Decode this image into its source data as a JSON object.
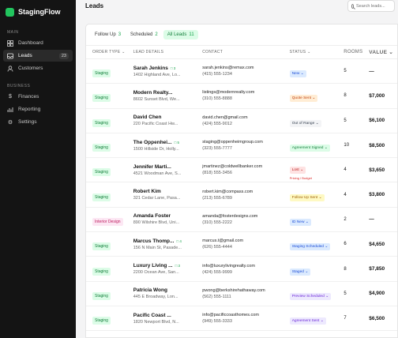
{
  "app": {
    "name": "StagingFlow"
  },
  "sidebar": {
    "section_main": "MAIN",
    "section_business": "BUSINESS",
    "items": [
      {
        "label": "Dashboard",
        "icon": "grid-icon"
      },
      {
        "label": "Leads",
        "icon": "inbox-icon",
        "badge": "23"
      },
      {
        "label": "Customers",
        "icon": "user-icon"
      },
      {
        "label": "Finances",
        "icon": "dollar-icon"
      },
      {
        "label": "Reporting",
        "icon": "chart-icon"
      },
      {
        "label": "Settings",
        "icon": "gear-icon"
      }
    ]
  },
  "header": {
    "title": "Leads",
    "search_placeholder": "Search leads..."
  },
  "tabs": [
    {
      "label": "Follow Up",
      "count": "3"
    },
    {
      "label": "Scheduled",
      "count": "2"
    },
    {
      "label": "All Leads",
      "count": "11"
    }
  ],
  "columns": [
    "ORDER TYPE ⌄",
    "LEAD DETAILS",
    "CONTACT",
    "STATUS ⌄",
    "ROOMS",
    "VALUE ⌄"
  ],
  "rows": [
    {
      "type": "Staging",
      "name": "Sarah Jenkins",
      "count": "□ 3",
      "address": "1402 Highland Ave, Lo...",
      "email": "sarah.jenkins@remax.com",
      "phone": "(415) 555-1234",
      "status": "New ⌄",
      "status_sub": "",
      "rooms": "5",
      "value": "—"
    },
    {
      "type": "Staging",
      "name": "Modern Realty...",
      "count": "",
      "address": "8602 Sunset Blvd, We...",
      "email": "listings@modernrealty.com",
      "phone": "(310) 555-8888",
      "status": "Quote Sent ⌄",
      "status_sub": "",
      "rooms": "8",
      "value": "$7,000"
    },
    {
      "type": "Staging",
      "name": "David Chen",
      "count": "",
      "address": "220 Pacific Coast Hw...",
      "email": "david.chen@gmail.com",
      "phone": "(424) 555-9012",
      "status": "Out of Range ⌄",
      "status_sub": "",
      "rooms": "5",
      "value": "$6,100"
    },
    {
      "type": "Staging",
      "name": "The Oppenhei...",
      "count": "□ 5",
      "address": "1500 Hillside Dr, Holly...",
      "email": "staging@oppenheimgroup.com",
      "phone": "(323) 555-7777",
      "status": "Agreement Signed ⌄",
      "status_sub": "",
      "rooms": "10",
      "value": "$8,500"
    },
    {
      "type": "Staging",
      "name": "Jennifer Marti...",
      "count": "",
      "address": "4521 Woodman Ave, S...",
      "email": "jmartinez@coldwellbanker.com",
      "phone": "(818) 555-3456",
      "status": "Lost ⌄",
      "status_sub": "Pricing / Budget",
      "rooms": "4",
      "value": "$3,650"
    },
    {
      "type": "Staging",
      "name": "Robert Kim",
      "count": "",
      "address": "321 Cedar Lane, Pasa...",
      "email": "robert.kim@compass.com",
      "phone": "(213) 555-6789",
      "status": "Follow Up Sent ⌄",
      "status_sub": "",
      "rooms": "4",
      "value": "$3,800"
    },
    {
      "type": "Interior Design",
      "name": "Amanda Foster",
      "count": "",
      "address": "890 Wilshire Blvd, Uni...",
      "email": "amanda@fosterdesigns.com",
      "phone": "(310) 555-2222",
      "status": "ID New ⌄",
      "status_sub": "",
      "rooms": "2",
      "value": "—"
    },
    {
      "type": "Staging",
      "name": "Marcus Thomp...",
      "count": "□ 4",
      "address": "156 N Main St, Pasade...",
      "email": "marcus.t@gmail.com",
      "phone": "(626) 555-4444",
      "status": "Staging Scheduled ⌄",
      "status_sub": "",
      "rooms": "6",
      "value": "$4,650"
    },
    {
      "type": "Staging",
      "name": "Luxury Living ...",
      "count": "□ 3",
      "address": "2200 Ocean Ave, San...",
      "email": "info@luxurylivingrealty.com",
      "phone": "(424) 555-9999",
      "status": "Staged ⌄",
      "status_sub": "",
      "rooms": "8",
      "value": "$7,850"
    },
    {
      "type": "Staging",
      "name": "Patricia Wong",
      "count": "",
      "address": "445 E Broadway, Lon...",
      "email": "pwong@berkshirehathaway.com",
      "phone": "(562) 555-1111",
      "status": "Preview Scheduled ⌄",
      "status_sub": "",
      "rooms": "5",
      "value": "$4,900"
    },
    {
      "type": "Staging",
      "name": "Pacific Coast ...",
      "count": "",
      "address": "1820 Newport Blvd, N...",
      "email": "info@pacificcoasthomes.com",
      "phone": "(949) 555-3333",
      "status": "Agreement Sent ⌄",
      "status_sub": "",
      "rooms": "7",
      "value": "$6,500"
    }
  ],
  "status_colors": {
    "New ⌄": "s-blue",
    "Quote Sent ⌄": "s-orange",
    "Out of Range ⌄": "s-gray",
    "Agreement Signed ⌄": "s-green",
    "Lost ⌄": "s-red",
    "Follow Up Sent ⌄": "s-yellow",
    "ID New ⌄": "s-blue",
    "Staging Scheduled ⌄": "s-blue",
    "Staged ⌄": "s-blue",
    "Preview Scheduled ⌄": "s-purple",
    "Agreement Sent ⌄": "s-purple"
  }
}
